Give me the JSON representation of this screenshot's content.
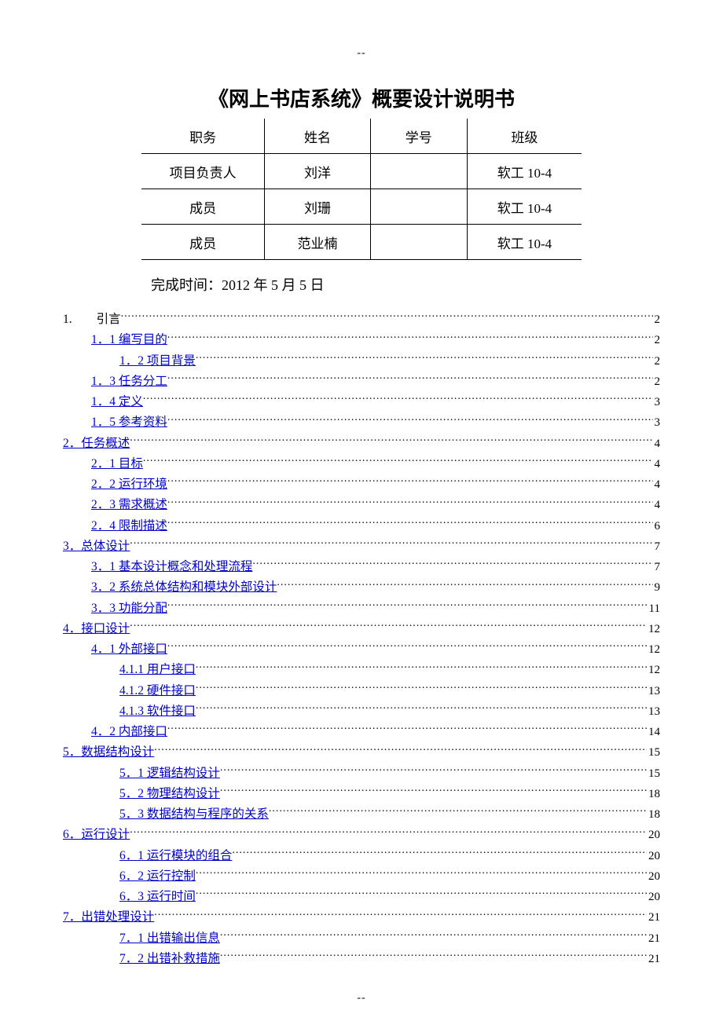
{
  "dashes": "--",
  "title": "《网上书店系统》概要设计说明书",
  "table": {
    "headers": [
      "职务",
      "姓名",
      "学号",
      "班级"
    ],
    "rows": [
      [
        "项目负责人",
        "刘洋",
        "",
        "软工 10-4"
      ],
      [
        "成员",
        "刘珊",
        "",
        "软工 10-4"
      ],
      [
        "成员",
        "范业楠",
        "",
        "软工 10-4"
      ]
    ]
  },
  "completion_label": "完成时间：2012 年 5 月 5 日",
  "toc": [
    {
      "indent": 0,
      "label": "1.",
      "spacer": "　　",
      "suffix": "引言",
      "page": "2",
      "link": false
    },
    {
      "indent": 1,
      "label": "1．1 编写目的",
      "page": "2",
      "link": true
    },
    {
      "indent": 2,
      "label": "1．2 项目背景",
      "page": "2",
      "link": true
    },
    {
      "indent": 1,
      "label": "1．3 任务分工",
      "page": "2",
      "link": true
    },
    {
      "indent": 1,
      "label": "1．4 定义",
      "page": "3",
      "link": true
    },
    {
      "indent": 1,
      "label": "1．5 参考资料",
      "page": "3",
      "link": true
    },
    {
      "indent": 0,
      "label": "2．任务概述",
      "page": "4",
      "link": true
    },
    {
      "indent": 1,
      "label": "2．1 目标",
      "page": "4",
      "link": true
    },
    {
      "indent": 1,
      "label": "2．2 运行环境",
      "page": "4",
      "link": true
    },
    {
      "indent": 1,
      "label": "2．3 需求概述",
      "page": "4",
      "link": true
    },
    {
      "indent": 1,
      "label": "2．4 限制描述",
      "page": "6",
      "link": true
    },
    {
      "indent": 0,
      "label": "3．总体设计",
      "page": "7",
      "link": true
    },
    {
      "indent": 1,
      "label": "3．1 基本设计概念和处理流程",
      "page": "7",
      "link": true
    },
    {
      "indent": 1,
      "label": "3．2 系统总体结构和模块外部设计",
      "page": "9",
      "link": true
    },
    {
      "indent": 1,
      "label": "3．3 功能分配",
      "page": "11",
      "link": true
    },
    {
      "indent": 0,
      "label": "4．接口设计",
      "page": "12",
      "link": true
    },
    {
      "indent": 1,
      "label": "4．1 外部接口",
      "page": "12",
      "link": true
    },
    {
      "indent": 2,
      "label": "4.1.1 用户接口",
      "page": "12",
      "link": true
    },
    {
      "indent": 2,
      "label": "4.1.2 硬件接口",
      "page": "13",
      "link": true
    },
    {
      "indent": 2,
      "label": "4.1.3 软件接口",
      "page": "13",
      "link": true
    },
    {
      "indent": 1,
      "label": "4．2 内部接口",
      "page": "14",
      "link": true
    },
    {
      "indent": 0,
      "label": "5．数据结构设计",
      "page": "15",
      "link": true
    },
    {
      "indent": 2,
      "label": "5．1 逻辑结构设计",
      "page": "15",
      "link": true
    },
    {
      "indent": 2,
      "label": "5．2 物理结构设计",
      "page": "18",
      "link": true
    },
    {
      "indent": 2,
      "label": "5．3 数据结构与程序的关系",
      "page": "18",
      "link": true
    },
    {
      "indent": 0,
      "label": "6．运行设计",
      "page": "20",
      "link": true
    },
    {
      "indent": 2,
      "label": "6．1 运行模块的组合",
      "page": "20",
      "link": true
    },
    {
      "indent": 2,
      "label": "6．2 运行控制",
      "page": "20",
      "link": true
    },
    {
      "indent": 2,
      "label": "6．3 运行时间",
      "page": "20",
      "link": true
    },
    {
      "indent": 0,
      "label": "7．出错处理设计",
      "page": "21",
      "link": true
    },
    {
      "indent": 2,
      "label": "7．1 出错输出信息",
      "page": "21",
      "link": true
    },
    {
      "indent": 2,
      "label": "7．2 出错补救措施",
      "page": "21",
      "link": true
    }
  ]
}
